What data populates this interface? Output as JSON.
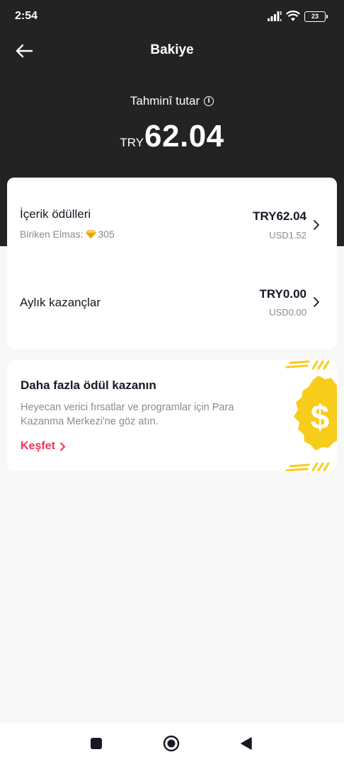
{
  "status_bar": {
    "time": "2:54",
    "battery": "23"
  },
  "header": {
    "title": "Bakiye",
    "estimate_label": "Tahminî tutar",
    "estimate_currency": "TRY",
    "estimate_value": "62.04"
  },
  "balance_rows": [
    {
      "title": "İçerik ödülleri",
      "subtitle": "Biriken Elmas:",
      "diamonds": "305",
      "amount": "TRY62.04",
      "usd": "USD1.52"
    },
    {
      "title": "Aylık kazançlar",
      "amount": "TRY0.00",
      "usd": "USD0.00"
    }
  ],
  "promo": {
    "title": "Daha fazla ödül kazanın",
    "description": "Heyecan verici fırsatlar ve programlar için Para Kazanma Merkezi'ne göz atın.",
    "link_label": "Keşfet"
  },
  "colors": {
    "header_bg": "#232323",
    "accent": "#fe2c55",
    "coin_yellow": "#f8cc1b"
  },
  "icons": {
    "back": "arrow-left-icon",
    "info": "info-circle-icon",
    "chevron": "chevron-right-icon",
    "diamond": "diamond-icon",
    "coin": "dollar-coin-icon"
  }
}
